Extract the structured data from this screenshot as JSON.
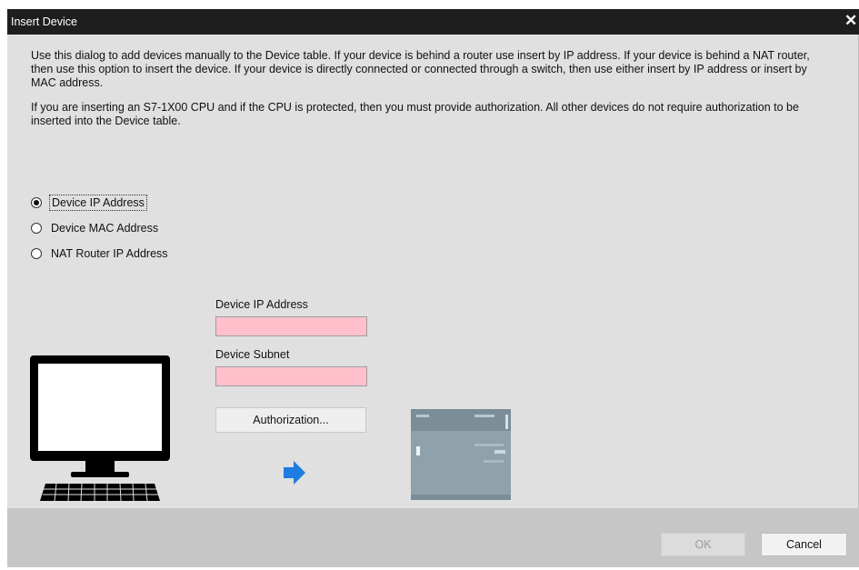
{
  "dialog": {
    "title": "Insert Device",
    "close_label": "✕"
  },
  "description": {
    "paragraph1": "Use this dialog to add devices manually to the Device table. If your device is behind a router use insert by IP address. If your device is behind a NAT router, then use this option to insert the device. If your device is directly connected or connected through a switch, then use either insert by IP address or insert by MAC address.",
    "paragraph2": "If you are inserting an S7-1X00 CPU and if the CPU is protected, then you must provide authorization. All other devices do not require authorization to be inserted into the Device table."
  },
  "options": {
    "selected": "Device IP Address",
    "items": [
      {
        "label": "Device IP Address",
        "checked": true
      },
      {
        "label": "Device MAC Address",
        "checked": false
      },
      {
        "label": "NAT Router IP Address",
        "checked": false
      }
    ]
  },
  "fields": {
    "ip_label": "Device IP Address",
    "ip_value": "",
    "subnet_label": "Device Subnet",
    "subnet_value": ""
  },
  "buttons": {
    "authorization": "Authorization...",
    "ok": "OK",
    "cancel": "Cancel"
  },
  "icons": {
    "computer": "computer-icon",
    "arrow": "arrow-right-icon",
    "plc": "plc-device-icon"
  },
  "colors": {
    "titlebar": "#1e1e1e",
    "dialog_bg": "#e0e0e0",
    "required_field": "#ffc0cb",
    "arrow": "#1e7be0",
    "plc": "#8fa1ab"
  }
}
